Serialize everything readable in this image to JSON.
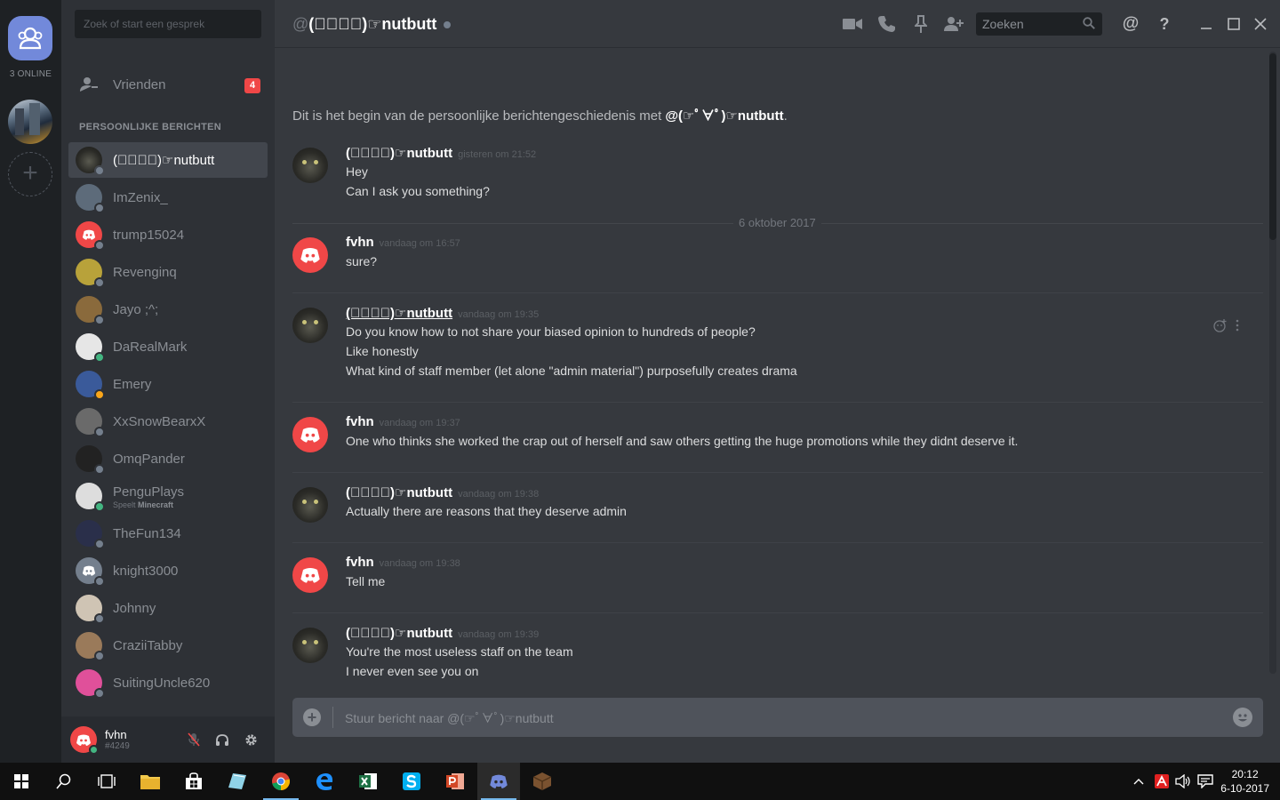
{
  "guilds": {
    "online_label": "3 ONLINE"
  },
  "dm_panel": {
    "search_placeholder": "Zoek of start een gesprek",
    "friends_label": "Vrienden",
    "friends_badge": "4",
    "section_header": "PERSOONLIJKE BERICHTEN",
    "items": [
      {
        "name": "(☞ﾟ∀ﾟ)☞nutbutt",
        "status_color": "#747f8d",
        "avatar": "cat",
        "active": true
      },
      {
        "name": "ImZenix_",
        "status_color": "#747f8d",
        "avatar": "#5d6b7a"
      },
      {
        "name": "trump15024",
        "status_color": "#747f8d",
        "avatar": "discord"
      },
      {
        "name": "Revenginq",
        "status_color": "#747f8d",
        "avatar": "#b8a23a"
      },
      {
        "name": "Jayo ;^;",
        "status_color": "#747f8d",
        "avatar": "#8a6a3c"
      },
      {
        "name": "DaRealMark",
        "status_color": "#43b581",
        "avatar": "#e6e6e6"
      },
      {
        "name": "Emery",
        "status_color": "#faa61a",
        "avatar": "#3a5a9a"
      },
      {
        "name": "XxSnowBearxX",
        "status_color": "#747f8d",
        "avatar": "#6a6a6a"
      },
      {
        "name": "OmqPander",
        "status_color": "#747f8d",
        "avatar": "#222222"
      },
      {
        "name": "PenguPlays",
        "status_color": "#43b581",
        "avatar": "#dddddd",
        "sub_prefix": "Speelt",
        "sub_game": "Minecraft"
      },
      {
        "name": "TheFun134",
        "status_color": "#747f8d",
        "avatar": "#2a2f4a"
      },
      {
        "name": "knight3000",
        "status_color": "#747f8d",
        "avatar": "discord-grey"
      },
      {
        "name": "Johnny",
        "status_color": "#747f8d",
        "avatar": "#cfc4b4"
      },
      {
        "name": "CraziiTabby",
        "status_color": "#747f8d",
        "avatar": "#9a7a5a"
      },
      {
        "name": "SuitingUncle620",
        "status_color": "#747f8d",
        "avatar": "#e0509a"
      }
    ]
  },
  "user": {
    "name": "fvhn",
    "discriminator": "#4249"
  },
  "channel": {
    "title": "(☞ﾟ∀ﾟ)☞nutbutt",
    "at": "@",
    "search_placeholder": "Zoeken"
  },
  "chat": {
    "intro_prefix": "Dit is het begin van de persoonlijke berichtengeschiedenis met ",
    "intro_name": "@(☞ﾟ∀ﾟ)☞nutbutt",
    "date_separator": "6 oktober 2017",
    "messages": [
      {
        "author": "(☞ﾟ∀ﾟ)☞nutbutt",
        "time": "gisteren om 21:52",
        "lines": [
          "Hey",
          "Can I ask you something?"
        ]
      },
      {
        "author": "fvhn",
        "time": "vandaag om 16:57",
        "lines": [
          "sure?"
        ]
      },
      {
        "author": "(☞ﾟ∀ﾟ)☞nutbutt",
        "time": "vandaag om 19:35",
        "lines": [
          "Do you know how to not share your biased opinion to hundreds of people?",
          "Like honestly",
          "What kind of staff member (let alone \"admin material\") purposefully creates drama"
        ]
      },
      {
        "author": "fvhn",
        "time": "vandaag om 19:37",
        "lines": [
          "One who thinks she worked the crap out of herself and saw others getting the huge promotions while they didnt deserve it."
        ]
      },
      {
        "author": "(☞ﾟ∀ﾟ)☞nutbutt",
        "time": "vandaag om 19:38",
        "lines": [
          "Actually there are reasons that they deserve admin"
        ]
      },
      {
        "author": "fvhn",
        "time": "vandaag om 19:38",
        "lines": [
          "Tell me"
        ]
      },
      {
        "author": "(☞ﾟ∀ﾟ)☞nutbutt",
        "time": "vandaag om 19:39",
        "lines": [
          "You're the most useless staff on the team",
          "I never even see you on"
        ]
      }
    ],
    "composer_placeholder": "Stuur bericht naar @(☞ﾟ∀ﾟ)☞nutbutt"
  },
  "taskbar": {
    "time": "20:12",
    "date": "6-10-2017"
  },
  "colors": {
    "brand": "#7289da",
    "danger": "#f04747",
    "online": "#43b581",
    "idle": "#faa61a",
    "offline": "#747f8d"
  }
}
